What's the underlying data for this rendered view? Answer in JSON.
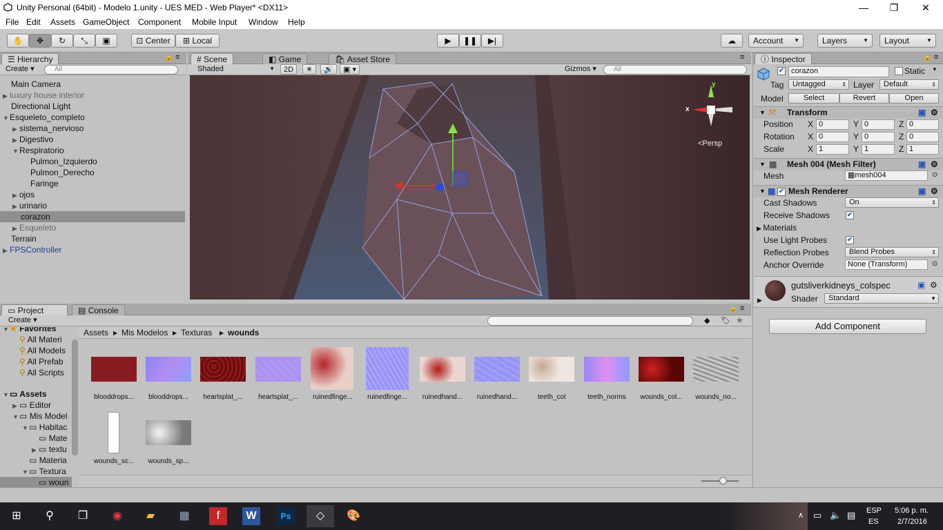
{
  "window": {
    "title": "Unity Personal (64bit) - Modelo 1.unity - UES MED - Web Player* <DX11>",
    "minimize": "—",
    "maximize": "❐",
    "close": "✕"
  },
  "menu": [
    "File",
    "Edit",
    "Assets",
    "GameObject",
    "Component",
    "Mobile Input",
    "Window",
    "Help"
  ],
  "toolbar": {
    "center": "Center",
    "local": "Local",
    "account": "Account",
    "layers": "Layers",
    "layout": "Layout"
  },
  "hierarchy": {
    "tab": "Hierarchy",
    "create": "Create",
    "search_placeholder": "All",
    "items": [
      "Main Camera",
      "luxury house interior",
      "Directional Light",
      "Esqueleto_completo",
      "sistema_nervioso",
      "Digestivo",
      "Respiratorio",
      "Pulmon_Izquierdo",
      "Pulmon_Derecho",
      "Faringe",
      "ojos",
      "urinario",
      "corazon",
      "Esqueleto",
      "Terrain",
      "FPSController"
    ]
  },
  "scene": {
    "tabs": [
      "Scene",
      "Game",
      "Asset Store"
    ],
    "shaded": "Shaded",
    "mode2d": "2D",
    "gizmos": "Gizmos",
    "search_placeholder": "All",
    "persp": "Persp",
    "axis_x": "x",
    "axis_y": "y"
  },
  "inspector": {
    "tab": "Inspector",
    "name": "corazon",
    "static": "Static",
    "tag_label": "Tag",
    "tag": "Untagged",
    "layer_label": "Layer",
    "layer": "Default",
    "model_label": "Model",
    "select": "Select",
    "revert": "Revert",
    "open": "Open",
    "transform": {
      "title": "Transform",
      "position": "Position",
      "rotation": "Rotation",
      "scale": "Scale",
      "pos": [
        "0",
        "0",
        "0"
      ],
      "rot": [
        "0",
        "0",
        "0"
      ],
      "scl": [
        "1",
        "1",
        "1"
      ],
      "x": "X",
      "y": "Y",
      "z": "Z"
    },
    "mesh_filter": {
      "title": "Mesh 004 (Mesh Filter)",
      "mesh_label": "Mesh",
      "mesh": "mesh004"
    },
    "mesh_renderer": {
      "title": "Mesh Renderer",
      "cast_shadows": "Cast Shadows",
      "cast_value": "On",
      "receive_shadows": "Receive Shadows",
      "materials": "Materials",
      "light_probes": "Use Light Probes",
      "reflection_probes": "Reflection Probes",
      "reflection_value": "Blend Probes",
      "anchor_override": "Anchor Override",
      "anchor_value": "None (Transform)"
    },
    "material": {
      "name": "gutsliverkidneys_colspec",
      "shader_label": "Shader",
      "shader": "Standard"
    },
    "add_component": "Add Component"
  },
  "project": {
    "tabs": [
      "Project",
      "Console"
    ],
    "create": "Create",
    "tree": [
      "Favorites",
      "All Materi",
      "All Models",
      "All Prefab",
      "All Scripts",
      "Assets",
      "Editor",
      "Mis Model",
      "Habitac",
      "Mate",
      "textu",
      "Materia",
      "Textura",
      "woun"
    ],
    "breadcrumb": [
      "Assets",
      "Mis Modelos",
      "Texturas",
      "wounds"
    ],
    "assets": [
      "blooddrops...",
      "blooddrops...",
      "heartsplat_...",
      "heartsplat_...",
      "ruinedfinge...",
      "ruinedfinge...",
      "ruinedhand...",
      "ruinedhand...",
      "teeth_col",
      "teeth_norms",
      "wounds_col...",
      "wounds_no...",
      "wounds_sc...",
      "wounds_sp..."
    ]
  },
  "taskbar": {
    "lang1": "ESP",
    "lang2": "ES",
    "time": "5:06 p. m.",
    "date": "2/7/2016"
  },
  "colors": {
    "selected_row": "#8f8f8f",
    "accent_blue": "#2a54b5"
  }
}
